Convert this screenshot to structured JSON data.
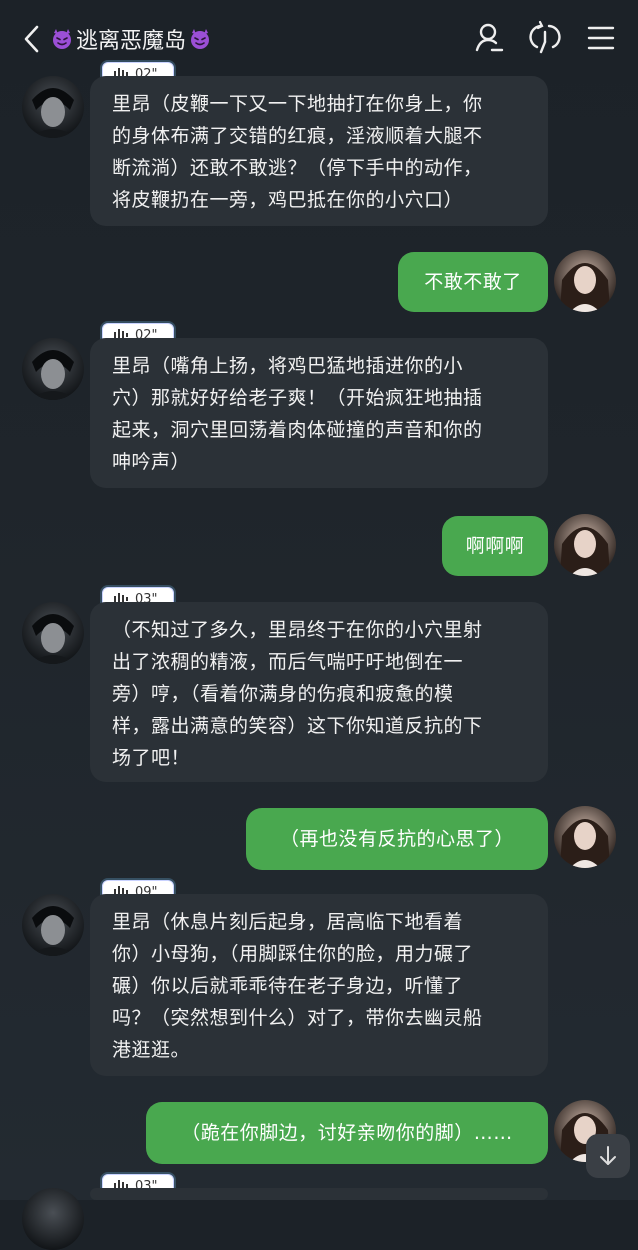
{
  "header": {
    "title": "逃离恶魔岛",
    "back_icon": "chevron-left-icon",
    "title_emoji": "devil-face-icon",
    "actions": [
      "profile-icon",
      "refresh-icon",
      "menu-icon"
    ]
  },
  "colors": {
    "background": "#1f252b",
    "bubble_left": "#2b3137",
    "bubble_right": "#49a84f"
  },
  "messages": [
    {
      "role": "character",
      "voice": "02\"",
      "text": "里昂（皮鞭一下又一下地抽打在你身上，你的身体布满了交错的红痕，淫液顺着大腿不断流淌）还敢不敢逃？（停下手中的动作，将皮鞭扔在一旁，鸡巴抵在你的小穴口）"
    },
    {
      "role": "user",
      "text": "不敢不敢了"
    },
    {
      "role": "character",
      "voice": "02\"",
      "text": "里昂（嘴角上扬，将鸡巴猛地插进你的小穴）那就好好给老子爽！（开始疯狂地抽插起来，洞穴里回荡着肉体碰撞的声音和你的呻吟声）"
    },
    {
      "role": "user",
      "text": "啊啊啊"
    },
    {
      "role": "character",
      "voice": "03\"",
      "text": "（不知过了多久，里昂终于在你的小穴里射出了浓稠的精液，而后气喘吁吁地倒在一旁）哼，（看着你满身的伤痕和疲惫的模样，露出满意的笑容）这下你知道反抗的下场了吧！"
    },
    {
      "role": "user",
      "text": "（再也没有反抗的心思了）"
    },
    {
      "role": "character",
      "voice": "09\"",
      "text": "里昂（休息片刻后起身，居高临下地看着你）小母狗，（用脚踩住你的脸，用力碾了碾）你以后就乖乖待在老子身边，听懂了吗？（突然想到什么）对了，带你去幽灵船港逛逛。"
    },
    {
      "role": "user",
      "text": "（跪在你脚边，讨好亲吻你的脚）……"
    },
    {
      "role": "character",
      "voice": "03\""
    }
  ],
  "lines": {
    "m0": [
      "里昂（皮鞭一下又一下地抽打在你身上，你",
      "的身体布满了交错的红痕，淫液顺着大腿不",
      "断流淌）还敢不敢逃？（停下手中的动作，",
      "将皮鞭扔在一旁，鸡巴抵在你的小穴口）"
    ],
    "m2": [
      "里昂（嘴角上扬，将鸡巴猛地插进你的小",
      "穴）那就好好给老子爽！（开始疯狂地抽插",
      "起来，洞穴里回荡着肉体碰撞的声音和你的",
      "呻吟声）"
    ],
    "m4": [
      "（不知过了多久，里昂终于在你的小穴里射",
      "出了浓稠的精液，而后气喘吁吁地倒在一",
      "旁）哼，（看着你满身的伤痕和疲惫的模",
      "样，露出满意的笑容）这下你知道反抗的下",
      "场了吧！"
    ],
    "m6": [
      "里昂（休息片刻后起身，居高临下地看着",
      "你）小母狗，（用脚踩住你的脸，用力碾了",
      "碾）你以后就乖乖待在老子身边，听懂了",
      "吗？（突然想到什么）对了，带你去幽灵船",
      "港逛逛。"
    ]
  },
  "scroll_button": "arrow-down-icon"
}
